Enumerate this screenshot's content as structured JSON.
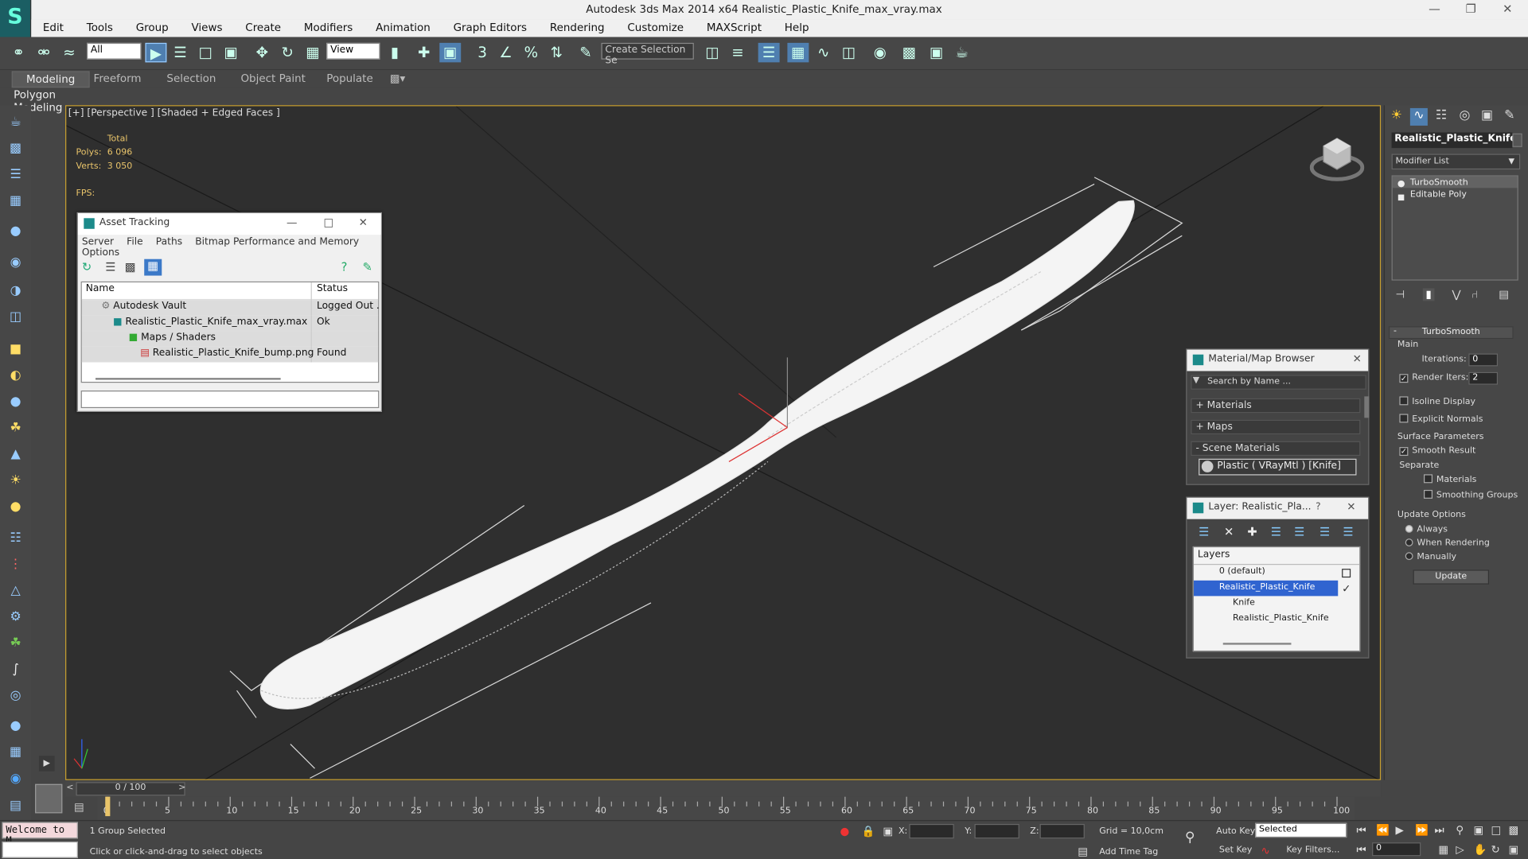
{
  "window": {
    "title": "Autodesk 3ds Max  2014 x64    Realistic_Plastic_Knife_max_vray.max"
  },
  "menu": [
    "Edit",
    "Tools",
    "Group",
    "Views",
    "Create",
    "Modifiers",
    "Animation",
    "Graph Editors",
    "Rendering",
    "Customize",
    "MAXScript",
    "Help"
  ],
  "toolbar": {
    "filter": "All",
    "refcoord": "View",
    "selset": "Create Selection Se"
  },
  "ribbon": {
    "tabs": [
      "Modeling",
      "Freeform",
      "Selection",
      "Object Paint",
      "Populate"
    ],
    "active": "Modeling",
    "subpanel": "Polygon Modeling"
  },
  "viewport": {
    "label": "[+] [Perspective ] [Shaded + Edged Faces ]",
    "stats": {
      "total": "Total",
      "polys_label": "Polys:",
      "polys": "6 096",
      "verts_label": "Verts:",
      "verts": "3 050",
      "fps": "FPS:"
    }
  },
  "asset_tracking": {
    "title": "Asset Tracking",
    "menu": [
      "Server",
      "File",
      "Paths",
      "Bitmap Performance and Memory",
      "Options"
    ],
    "columns": {
      "name": "Name",
      "status": "Status"
    },
    "rows": [
      {
        "name": "Autodesk Vault",
        "status": "Logged Out ..."
      },
      {
        "name": "Realistic_Plastic_Knife_max_vray.max",
        "status": "Ok"
      },
      {
        "name": "Maps / Shaders",
        "status": ""
      },
      {
        "name": "Realistic_Plastic_Knife_bump.png",
        "status": "Found"
      }
    ]
  },
  "material_browser": {
    "title": "Material/Map Browser",
    "search": "Search by Name ...",
    "sections": [
      "+ Materials",
      "+ Maps",
      "- Scene Materials"
    ],
    "scene_material": "Plastic  ( VRayMtl ) [Knife]"
  },
  "layer_explorer": {
    "title": "Layer: Realistic_Pla...",
    "help": "?",
    "header": "Layers",
    "rows": [
      "0 (default)",
      "Realistic_Plastic_Knife",
      "Knife",
      "Realistic_Plastic_Knife"
    ]
  },
  "command_panel": {
    "object_name": "Realistic_Plastic_Knife",
    "modifier_list": "Modifier List",
    "stack": [
      "TurboSmooth",
      "Editable Poly"
    ],
    "turbosmooth": {
      "title": "TurboSmooth",
      "main": "Main",
      "iterations_label": "Iterations:",
      "iterations": "0",
      "render_iters_label": "Render Iters:",
      "render_iters": "2",
      "isoline": "Isoline Display",
      "explicit": "Explicit Normals",
      "surface": "Surface Parameters",
      "smooth_result": "Smooth Result",
      "separate": "Separate",
      "materials": "Materials",
      "smoothing_groups": "Smoothing Groups",
      "update_options": "Update Options",
      "always": "Always",
      "when_rendering": "When Rendering",
      "manually": "Manually",
      "update": "Update"
    }
  },
  "timeline": {
    "frame": "0 / 100",
    "ticks": [
      "0",
      "5",
      "10",
      "15",
      "20",
      "25",
      "30",
      "35",
      "40",
      "45",
      "50",
      "55",
      "60",
      "65",
      "70",
      "75",
      "80",
      "85",
      "90",
      "95",
      "100"
    ],
    "current_frame": 0
  },
  "status": {
    "maxscript": "Welcome to M",
    "selected": "1 Group Selected",
    "prompt": "Click or click-and-drag to select objects",
    "x": "X:",
    "y": "Y:",
    "z": "Z:",
    "grid": "Grid = 10,0cm",
    "add_time_tag": "Add Time Tag",
    "auto_key": "Auto Key",
    "set_key": "Set Key",
    "key_mode": "Selected",
    "key_filters": "Key Filters...",
    "frame": "0"
  }
}
